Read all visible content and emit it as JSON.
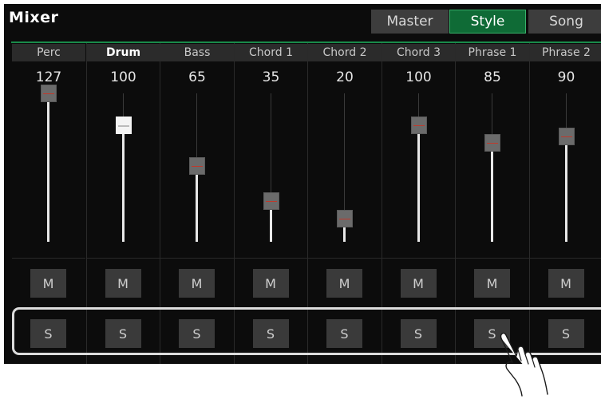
{
  "title": "Mixer",
  "tabs": [
    {
      "label": "Master",
      "active": false
    },
    {
      "label": "Style",
      "active": true
    },
    {
      "label": "Song",
      "active": false
    }
  ],
  "channels": [
    {
      "name": "Perc",
      "value": "127",
      "level": 127,
      "selected": false
    },
    {
      "name": "Drum",
      "value": "100",
      "level": 100,
      "selected": true
    },
    {
      "name": "Bass",
      "value": "65",
      "level": 65,
      "selected": false
    },
    {
      "name": "Chord 1",
      "value": "35",
      "level": 35,
      "selected": false
    },
    {
      "name": "Chord 2",
      "value": "20",
      "level": 20,
      "selected": false
    },
    {
      "name": "Chord 3",
      "value": "100",
      "level": 100,
      "selected": false
    },
    {
      "name": "Phrase 1",
      "value": "85",
      "level": 85,
      "selected": false
    },
    {
      "name": "Phrase 2",
      "value": "90",
      "level": 90,
      "selected": false
    }
  ],
  "mute_label": "M",
  "solo_label": "S",
  "colors": {
    "accent_green": "#0f6b36",
    "background": "#0c0c0c"
  },
  "icons": [
    "pointing-hand-icon"
  ]
}
